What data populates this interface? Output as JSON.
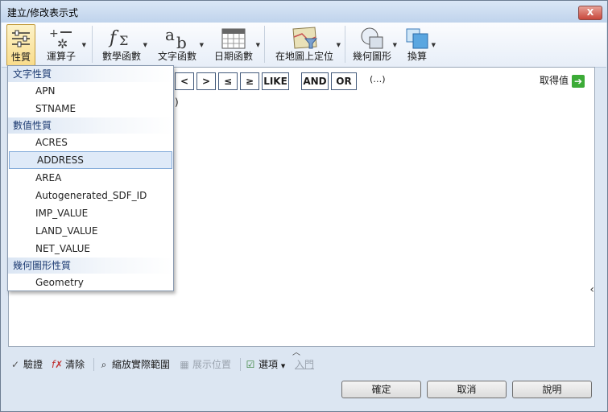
{
  "window": {
    "title": "建立/修改表示式",
    "close_label": "X"
  },
  "ribbon": {
    "properties": "性質",
    "operators": "運算子",
    "math_functions": "數學函數",
    "text_functions": "文字函數",
    "date_functions": "日期函數",
    "locate_on_map": "在地圖上定位",
    "geometry": "幾何圖形",
    "convert": "換算"
  },
  "operators": {
    "lt": "<",
    "gt": ">",
    "le": "≤",
    "ge": "≥",
    "like": "LIKE",
    "and": "AND",
    "or": "OR",
    "paren": "(…)",
    "get_value": "取得值",
    "get_value_icon": "➔"
  },
  "editor": {
    "visible_text": ")"
  },
  "dropdown": {
    "groups": [
      {
        "title": "文字性質",
        "items": [
          "APN",
          "STNAME"
        ]
      },
      {
        "title": "數值性質",
        "items": [
          "ACRES",
          "ADDRESS",
          "AREA",
          "Autogenerated_SDF_ID",
          "IMP_VALUE",
          "LAND_VALUE",
          "NET_VALUE"
        ]
      },
      {
        "title": "幾何圖形性質",
        "items": [
          "Geometry"
        ]
      }
    ],
    "highlighted": "ADDRESS"
  },
  "bottom": {
    "validate": "驗證",
    "clear": "清除",
    "zoom_extents": "縮放實際範圍",
    "show_position": "展示位置",
    "options": "選項",
    "import": "入門"
  },
  "buttons": {
    "ok": "確定",
    "cancel": "取消",
    "help": "說明"
  },
  "colors": {
    "highlight": "#dfeaf8",
    "group_text": "#1e3c73",
    "go_green": "#3cab37"
  }
}
